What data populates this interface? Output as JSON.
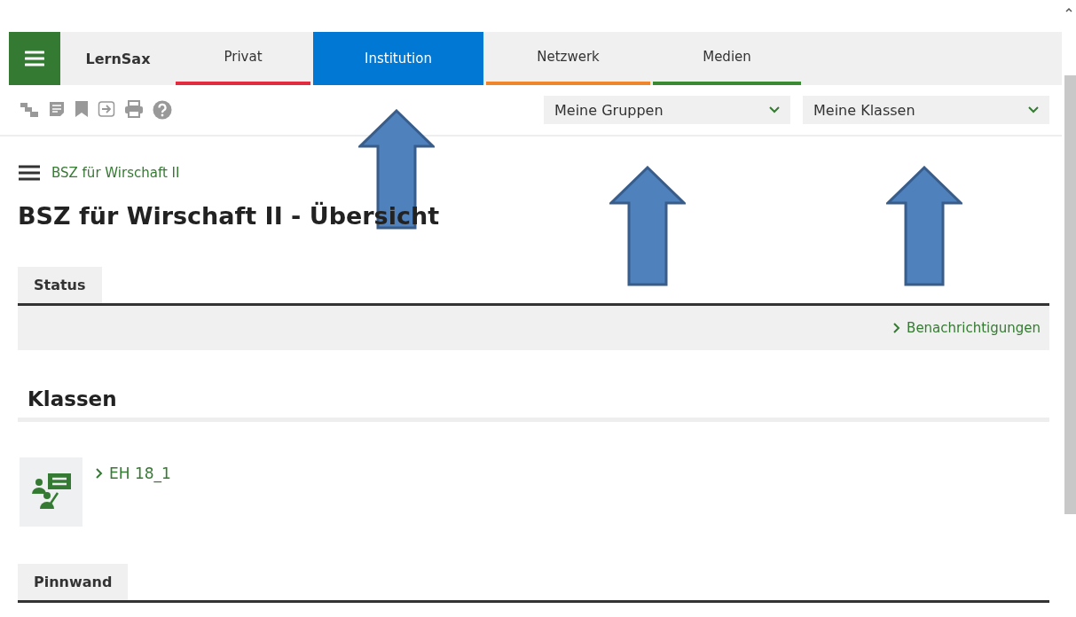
{
  "nav": {
    "brand": "LernSax",
    "tabs": [
      {
        "label": "Privat",
        "selected": false,
        "color": "#e32b3f"
      },
      {
        "label": "Institution",
        "selected": true,
        "color": "#0078d4"
      },
      {
        "label": "Netzwerk",
        "selected": false,
        "color": "#f0862b"
      },
      {
        "label": "Medien",
        "selected": false,
        "color": "#3a8a34"
      }
    ]
  },
  "selects": [
    {
      "value": "Meine Gruppen"
    },
    {
      "value": "Meine Klassen"
    }
  ],
  "breadcrumb": "BSZ für Wirschaft II",
  "title": "BSZ für Wirschaft II - Übersicht",
  "status": {
    "tab": "Status",
    "link": "Benachrichtigungen"
  },
  "classes": {
    "heading": "Klassen",
    "items": [
      {
        "label": "EH 18_1"
      }
    ]
  },
  "pinboard": {
    "tab": "Pinnwand"
  }
}
